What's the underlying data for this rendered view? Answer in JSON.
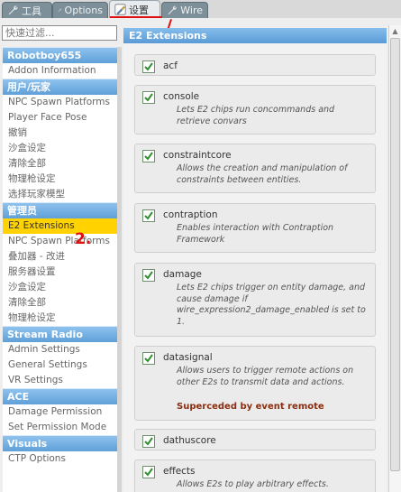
{
  "tabs": [
    {
      "label": "工具",
      "icon": "wrench-icon",
      "active": false
    },
    {
      "label": "Options",
      "icon": "wrench-icon",
      "active": false
    },
    {
      "label": "设置",
      "icon": "paintbrush-icon",
      "active": true
    },
    {
      "label": "Wire",
      "icon": "wrench-icon",
      "active": false
    }
  ],
  "filter": {
    "placeholder": "快速过滤..."
  },
  "sidebar": {
    "categories": [
      {
        "title": "Robotboy655",
        "items": [
          "Addon Information"
        ]
      },
      {
        "title": "用户/玩家",
        "items": [
          "NPC Spawn Platforms",
          "Player Face Pose",
          "撤销",
          "沙盒设定",
          "清除全部",
          "物理枪设定",
          "选择玩家模型"
        ]
      },
      {
        "title": "管理员",
        "items": [
          "E2 Extensions",
          "NPC Spawn Platforms",
          "叠加器 - 改进",
          "服务器设置",
          "沙盒设定",
          "清除全部",
          "物理枪设定"
        ]
      },
      {
        "title": "Stream Radio",
        "items": [
          "Admin Settings",
          "General Settings",
          "VR Settings"
        ]
      },
      {
        "title": "ACE",
        "items": [
          "Damage Permission",
          "Set Permission Mode"
        ]
      },
      {
        "title": "Visuals",
        "items": [
          "CTP Options"
        ]
      }
    ],
    "selected": "E2 Extensions"
  },
  "annotations": {
    "step_number": "2."
  },
  "panel": {
    "title": "E2 Extensions",
    "extensions": [
      {
        "name": "acf",
        "checked": true,
        "description": ""
      },
      {
        "name": "console",
        "checked": true,
        "description": "Lets E2 chips run concommands and retrieve convars"
      },
      {
        "name": "constraintcore",
        "checked": true,
        "description": "Allows the creation and manipulation of constraints between entities."
      },
      {
        "name": "contraption",
        "checked": true,
        "description": "Enables interaction with Contraption Framework"
      },
      {
        "name": "damage",
        "checked": true,
        "description": "Lets E2 chips trigger on entity damage, and cause damage if wire_expression2_damage_enabled is set to 1."
      },
      {
        "name": "datasignal",
        "checked": true,
        "description": "Allows users to trigger remote actions on other E2s to transmit data and actions.",
        "note": "Superceded by event remote"
      },
      {
        "name": "dathuscore",
        "checked": true,
        "description": ""
      },
      {
        "name": "effects",
        "checked": true,
        "description": "Allows E2s to play arbitrary effects."
      }
    ]
  },
  "colors": {
    "category_header": "#5fa0d8",
    "selected_item": "#ffd200",
    "annotation_red": "#e01010",
    "note_color": "#8b2e10"
  }
}
